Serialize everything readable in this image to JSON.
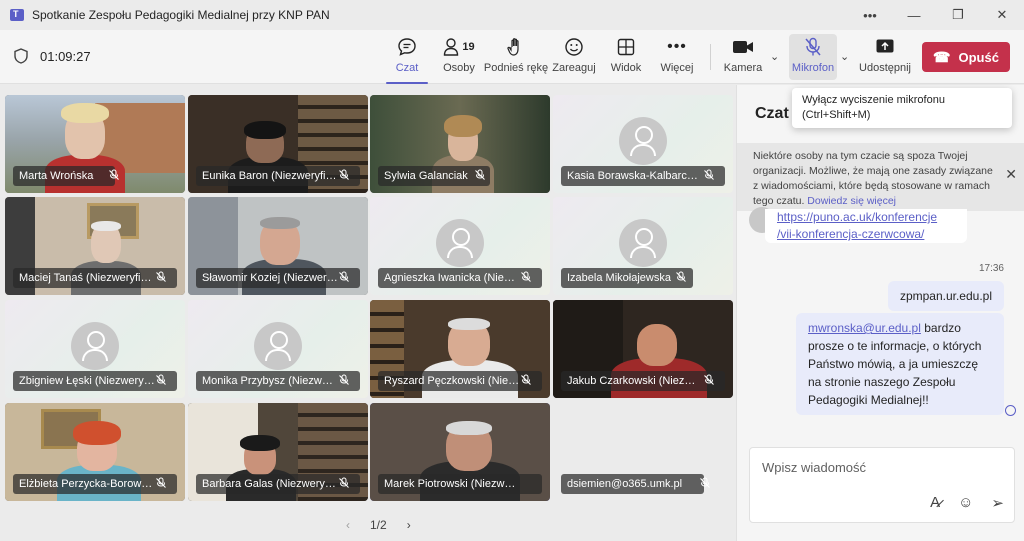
{
  "window": {
    "title": "Spotkanie Zespołu Pedagogiki Medialnej przy KNP PAN"
  },
  "toolbar": {
    "timer": "01:09:27",
    "chat_label": "Czat",
    "people_label": "Osoby",
    "people_count": "19",
    "raise_label": "Podnieś rękę",
    "react_label": "Zareaguj",
    "view_label": "Widok",
    "more_label": "Więcej",
    "camera_label": "Kamera",
    "mic_label": "Mikrofon",
    "share_label": "Udostępnij",
    "leave_label": "Opuść"
  },
  "tooltip": {
    "line1": "Wyłącz wyciszenie mikrofonu",
    "line2": "(Ctrl+Shift+M)"
  },
  "participants": [
    {
      "name": "Marta Wrońska"
    },
    {
      "name": "Eunika Baron (Niezweryfikowany)"
    },
    {
      "name": "Sylwia Galanciak"
    },
    {
      "name": "Kasia Borawska-Kalbarczyk"
    },
    {
      "name": "Maciej Tanaś (Niezweryfikowany)"
    },
    {
      "name": "Sławomir Koziej (Niezweryfikowany)"
    },
    {
      "name": "Agnieszka Iwanicka (Niezweryfikowany)"
    },
    {
      "name": "Izabela Mikołajewska"
    },
    {
      "name": "Zbigniew Łęski (Niezweryfikowany)"
    },
    {
      "name": "Monika Przybysz (Niezweryfikowany)"
    },
    {
      "name": "Ryszard Pęczkowski (Niezweryfikowany)"
    },
    {
      "name": "Jakub Czarkowski (Niezweryfikowany)"
    },
    {
      "name": "Elżbieta Perzycka-Borowska"
    },
    {
      "name": "Barbara Galas (Niezweryfikowany)"
    },
    {
      "name": "Marek Piotrowski (Niezweryfikowany)"
    },
    {
      "name": "dsiemien@o365.umk.pl"
    }
  ],
  "pager": {
    "text": "1/2"
  },
  "chat": {
    "title": "Czat",
    "banner_text": "Niektóre osoby na tym czacie są spoza Twojej organizacji. Możliwe, że mają one zasady związane z wiadomościami, które będą stosowane w ramach tego czatu.",
    "banner_link": "Dowiedz się więcej",
    "link_line1": "https://puno.ac.uk/konferencje",
    "link_line2": "/vii-konferencja-czerwcowa/",
    "time": "17:36",
    "msg1": "zpmpan.ur.edu.pl",
    "msg2_link": "mwronska@ur.edu.pl",
    "msg2_text": "bardzo prosze o te informacje, o których Państwo mówią, a ja umieszczę na stronie naszego Zespołu Pedagogiki Medialnej!!",
    "compose_placeholder": "Wpisz wiadomość"
  },
  "colors": {
    "accent": "#5b5fc7",
    "leave": "#c4314b",
    "bubble": "#e8ebfa"
  }
}
